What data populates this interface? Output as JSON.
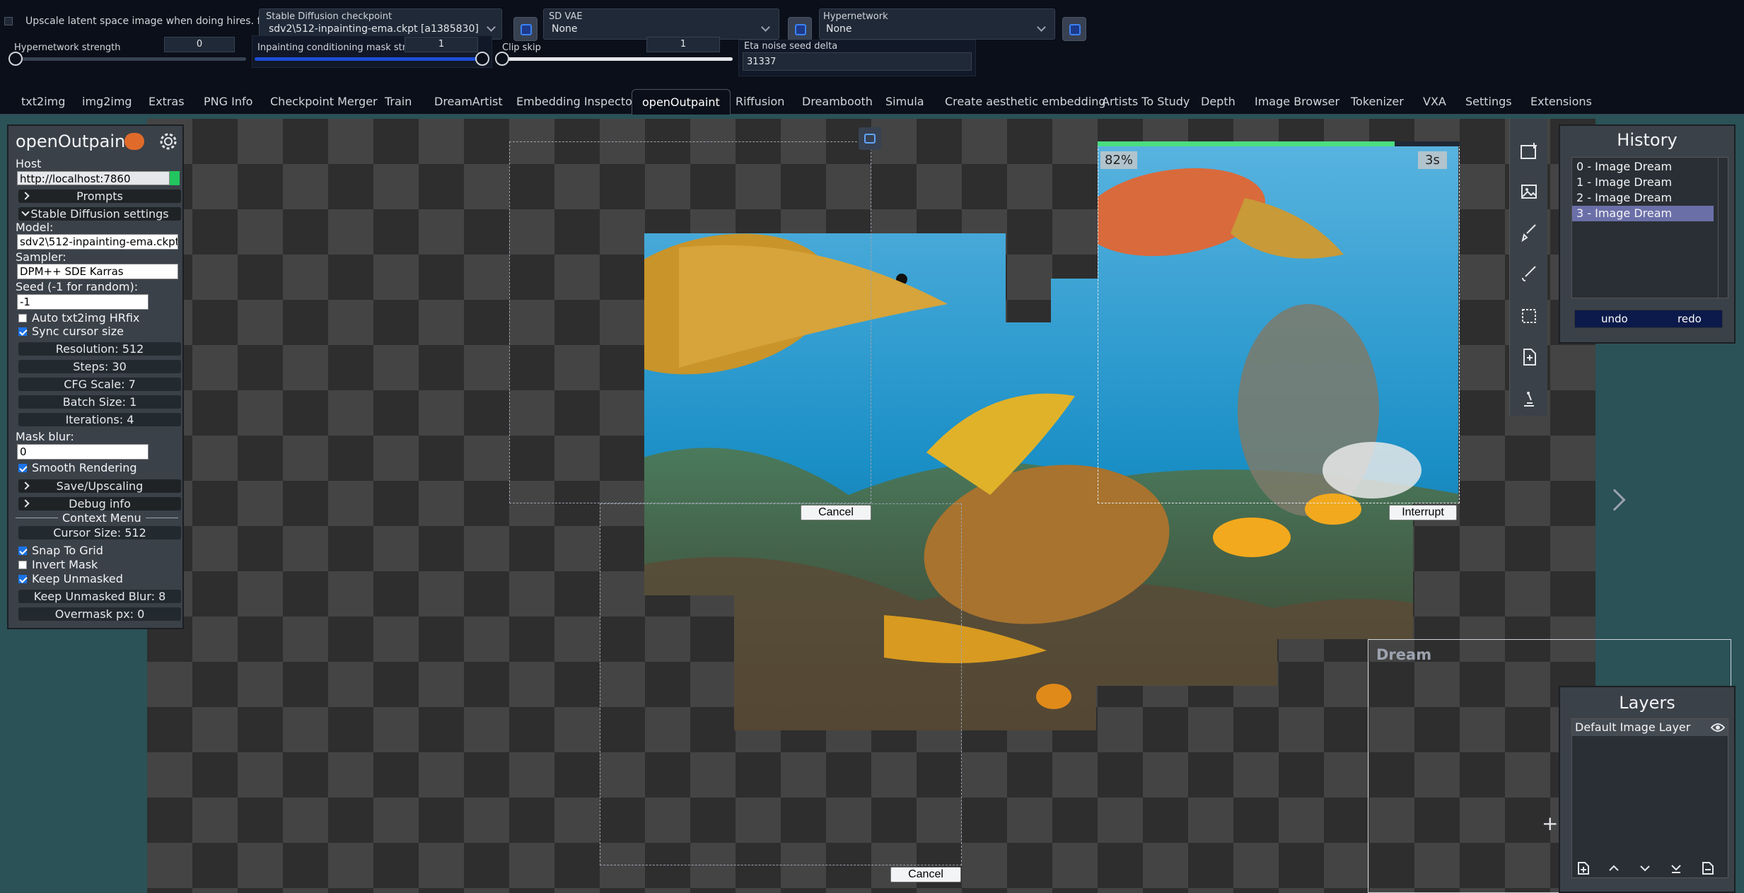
{
  "settings": {
    "upscale_label": "Upscale latent space image when doing hires. fix",
    "checkpoint_label": "Stable Diffusion checkpoint",
    "checkpoint_value": "sdv2\\512-inpainting-ema.ckpt [a1385830]",
    "vae_label": "SD VAE",
    "vae_value": "None",
    "hypernetwork_label": "Hypernetwork",
    "hypernetwork_value": "None",
    "hn_strength_label": "Hypernetwork strength",
    "hn_strength_value": "0",
    "hn_strength_level": 0,
    "mask_strength_label": "Inpainting conditioning mask strength",
    "mask_strength_value": "1",
    "mask_strength_level": 1,
    "clip_skip_label": "Clip skip",
    "clip_skip_value": "1",
    "clip_skip_level": 0,
    "eta_label": "Eta noise seed delta",
    "eta_value": "31337"
  },
  "tabs": [
    "txt2img",
    "img2img",
    "Extras",
    "PNG Info",
    "Checkpoint Merger",
    "Train",
    "DreamArtist",
    "Embedding Inspector",
    "openOutpaint",
    "Riffusion",
    "Dreambooth",
    "Simula",
    "Create aesthetic embedding",
    "Artists To Study",
    "Depth",
    "Image Browser",
    "Tokenizer",
    "VXA",
    "Settings",
    "Extensions"
  ],
  "active_tab": "openOutpaint",
  "panel": {
    "title": "openOutpaint",
    "host_label": "Host",
    "host_value": "http://localhost:7860",
    "prompts": "Prompts",
    "sd_settings": "Stable Diffusion settings",
    "model_label": "Model:",
    "model_value": "sdv2\\512-inpainting-ema.ckpt [",
    "sampler_label": "Sampler:",
    "sampler_value": "DPM++ SDE Karras",
    "seed_label": "Seed (-1 for random):",
    "seed_value": "-1",
    "auto_hrfix": "Auto txt2img HRfix",
    "sync_cursor": "Sync cursor size",
    "resolution": "Resolution: 512",
    "steps": "Steps: 30",
    "cfg": "CFG Scale: 7",
    "batch": "Batch Size: 1",
    "iterations": "Iterations: 4",
    "mask_blur_label": "Mask blur:",
    "mask_blur_value": "0",
    "smooth": "Smooth Rendering",
    "save_upscaling": "Save/Upscaling",
    "debug": "Debug info",
    "context_menu": "Context Menu",
    "cursor_size": "Cursor Size: 512",
    "snap": "Snap To Grid",
    "invert": "Invert Mask",
    "keep_unmasked": "Keep Unmasked",
    "keep_blur": "Keep Unmasked Blur: 8",
    "overmask": "Overmask px: 0"
  },
  "canvas": {
    "progress": "82%",
    "progress_level": 0.82,
    "time": "3s",
    "cancel": "Cancel",
    "interrupt": "Interrupt",
    "cancel2": "Cancel",
    "dream": "Dream"
  },
  "history": {
    "title": "History",
    "items": [
      "0 - Image Dream",
      "1 - Image Dream",
      "2 - Image Dream",
      "3 - Image Dream"
    ],
    "selected": 3,
    "undo": "undo",
    "redo": "redo"
  },
  "layers": {
    "title": "Layers",
    "items": [
      "Default Image Layer"
    ]
  },
  "colors": {
    "accent": "#1d4ed8",
    "app_bg": "#2a5257",
    "panel": "#3b4149",
    "progress": "#4ade80"
  },
  "icons": [
    "refresh-icon",
    "gear-icon",
    "eye-icon",
    "chevron-right-icon",
    "plus-icon"
  ]
}
